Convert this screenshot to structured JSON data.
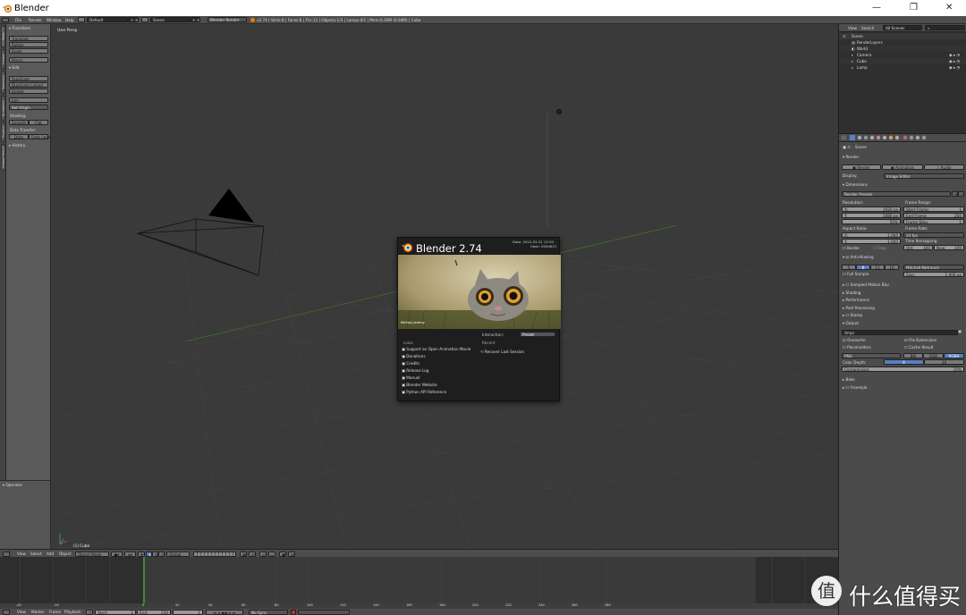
{
  "window": {
    "title": "Blender",
    "minimize": "—",
    "maximize": "❐",
    "close": "✕"
  },
  "info_header": {
    "menus": [
      "File",
      "Render",
      "Window",
      "Help"
    ],
    "screen_layout": "Default",
    "scene": "Scene",
    "engine": "Blender Render",
    "stats": "v2.74 | Verts:8 | Faces:6 | Tris:12 | Objects:1/3 | Lamps:0/1 | Mem:6.26M (0.64M) | Cube"
  },
  "toolshelf": {
    "tabs": [
      "Tools",
      "Create",
      "Relations",
      "Animation",
      "Physics",
      "Grease Pencil"
    ],
    "transform_header": "Transform",
    "transform_buttons": [
      "Translate",
      "Rotate",
      "Scale"
    ],
    "mirror": "Mirror",
    "edit_header": "Edit",
    "edit_buttons": [
      "Duplicate",
      "Duplicate Linked",
      "Delete",
      "Join"
    ],
    "set_origin": "Set Origin",
    "shading_label": "Shading:",
    "smooth": "Smooth",
    "flat": "Flat",
    "data_transfer_label": "Data Transfer:",
    "data": "Data",
    "data_layout": "Data Layo",
    "history_header": "History"
  },
  "operator_header": "Operator",
  "viewport": {
    "label": "User Persp",
    "object_label": "(1) Cube"
  },
  "outliner": {
    "view": "View",
    "search": "Search",
    "scope": "All Scenes",
    "items": [
      "Scene",
      "RenderLayers",
      "World",
      "Camera",
      "Cube",
      "Lamp"
    ]
  },
  "properties": {
    "scene_label": "Scene",
    "render_header": "Render",
    "render_btn": "Render",
    "animation_btn": "Animation",
    "audio_btn": "Audio",
    "display_label": "Display:",
    "display_value": "Image Editor",
    "dimensions_header": "Dimensions",
    "render_presets": "Render Presets",
    "resolution_label": "Resolution:",
    "res_x": "X:",
    "res_x_val": "1920 px",
    "res_y": "Y:",
    "res_y_val": "1080 px",
    "res_pct": "50%",
    "frame_range_label": "Frame Range:",
    "start_frame": "Start Frame:",
    "start_frame_val": "1",
    "end_frame": "End Frame:",
    "end_frame_val": "250",
    "frame_step": "Frame Step:",
    "frame_step_val": "1",
    "aspect_label": "Aspect Ratio:",
    "aspect_x_val": "1.000",
    "aspect_y_val": "1.000",
    "frame_rate_label": "Frame Rate:",
    "fps": "24 fps",
    "border": "Border",
    "crop": "Crop",
    "time_remapping": "Time Remapping:",
    "old": "Old:",
    "old_val": "100",
    "new": "New:",
    "new_val": "100",
    "aa_header": "Anti-Aliasing",
    "aa_samples": [
      "5",
      "8",
      "11",
      "16"
    ],
    "aa_filter": "Mitchell-Netravali",
    "full_sample": "Full Sample",
    "size": "Size:",
    "size_val": "1.000 px",
    "collapsed_panels": [
      "Sampled Motion Blur",
      "Shading",
      "Performance",
      "Post Processing",
      "Stamp"
    ],
    "output_header": "Output",
    "output_path": "/tmp\\",
    "overwrite": "Overwrite",
    "file_extensions": "File Extensions",
    "placeholders": "Placeholders",
    "cache_result": "Cache Result",
    "format": "PNG",
    "color_modes": [
      "BW",
      "RGB",
      "RGBA"
    ],
    "color_depth_label": "Color Depth:",
    "color_depth": [
      "8",
      "16"
    ],
    "compression": "Compression:",
    "compression_val": "15%",
    "bake_header": "Bake",
    "freestyle_header": "Freestyle"
  },
  "viewport_header": {
    "menus": [
      "View",
      "Select",
      "Add",
      "Object"
    ],
    "mode": "Object Mode",
    "orientation": "Global"
  },
  "timeline": {
    "menus": [
      "View",
      "Marker",
      "Frame",
      "Playback"
    ],
    "start": "Start:",
    "start_val": "1",
    "end": "End:",
    "end_val": "250",
    "current": "1",
    "sync": "No Sync",
    "ticks": [
      "-40",
      "-20",
      "0",
      "20",
      "40",
      "60",
      "80",
      "100",
      "120",
      "140",
      "160",
      "180",
      "200",
      "220",
      "240",
      "260",
      "280"
    ]
  },
  "splash": {
    "title": "Blender 2.74",
    "date": "Date: 2015-03-31 13:39",
    "hash": "Hash: 000d613",
    "artist": "Minhey-Jeremy",
    "interaction_label": "Interaction:",
    "preset": "Preset",
    "links_header": "Links",
    "links": [
      "Support an Open Animation Movie",
      "Donations",
      "Credits",
      "Release Log",
      "Manual",
      "Blender Website",
      "Python API Reference"
    ],
    "recent_header": "Recent",
    "recover": "Recover Last Session"
  },
  "watermark": {
    "text": "什么值得买",
    "symbol": "值"
  }
}
